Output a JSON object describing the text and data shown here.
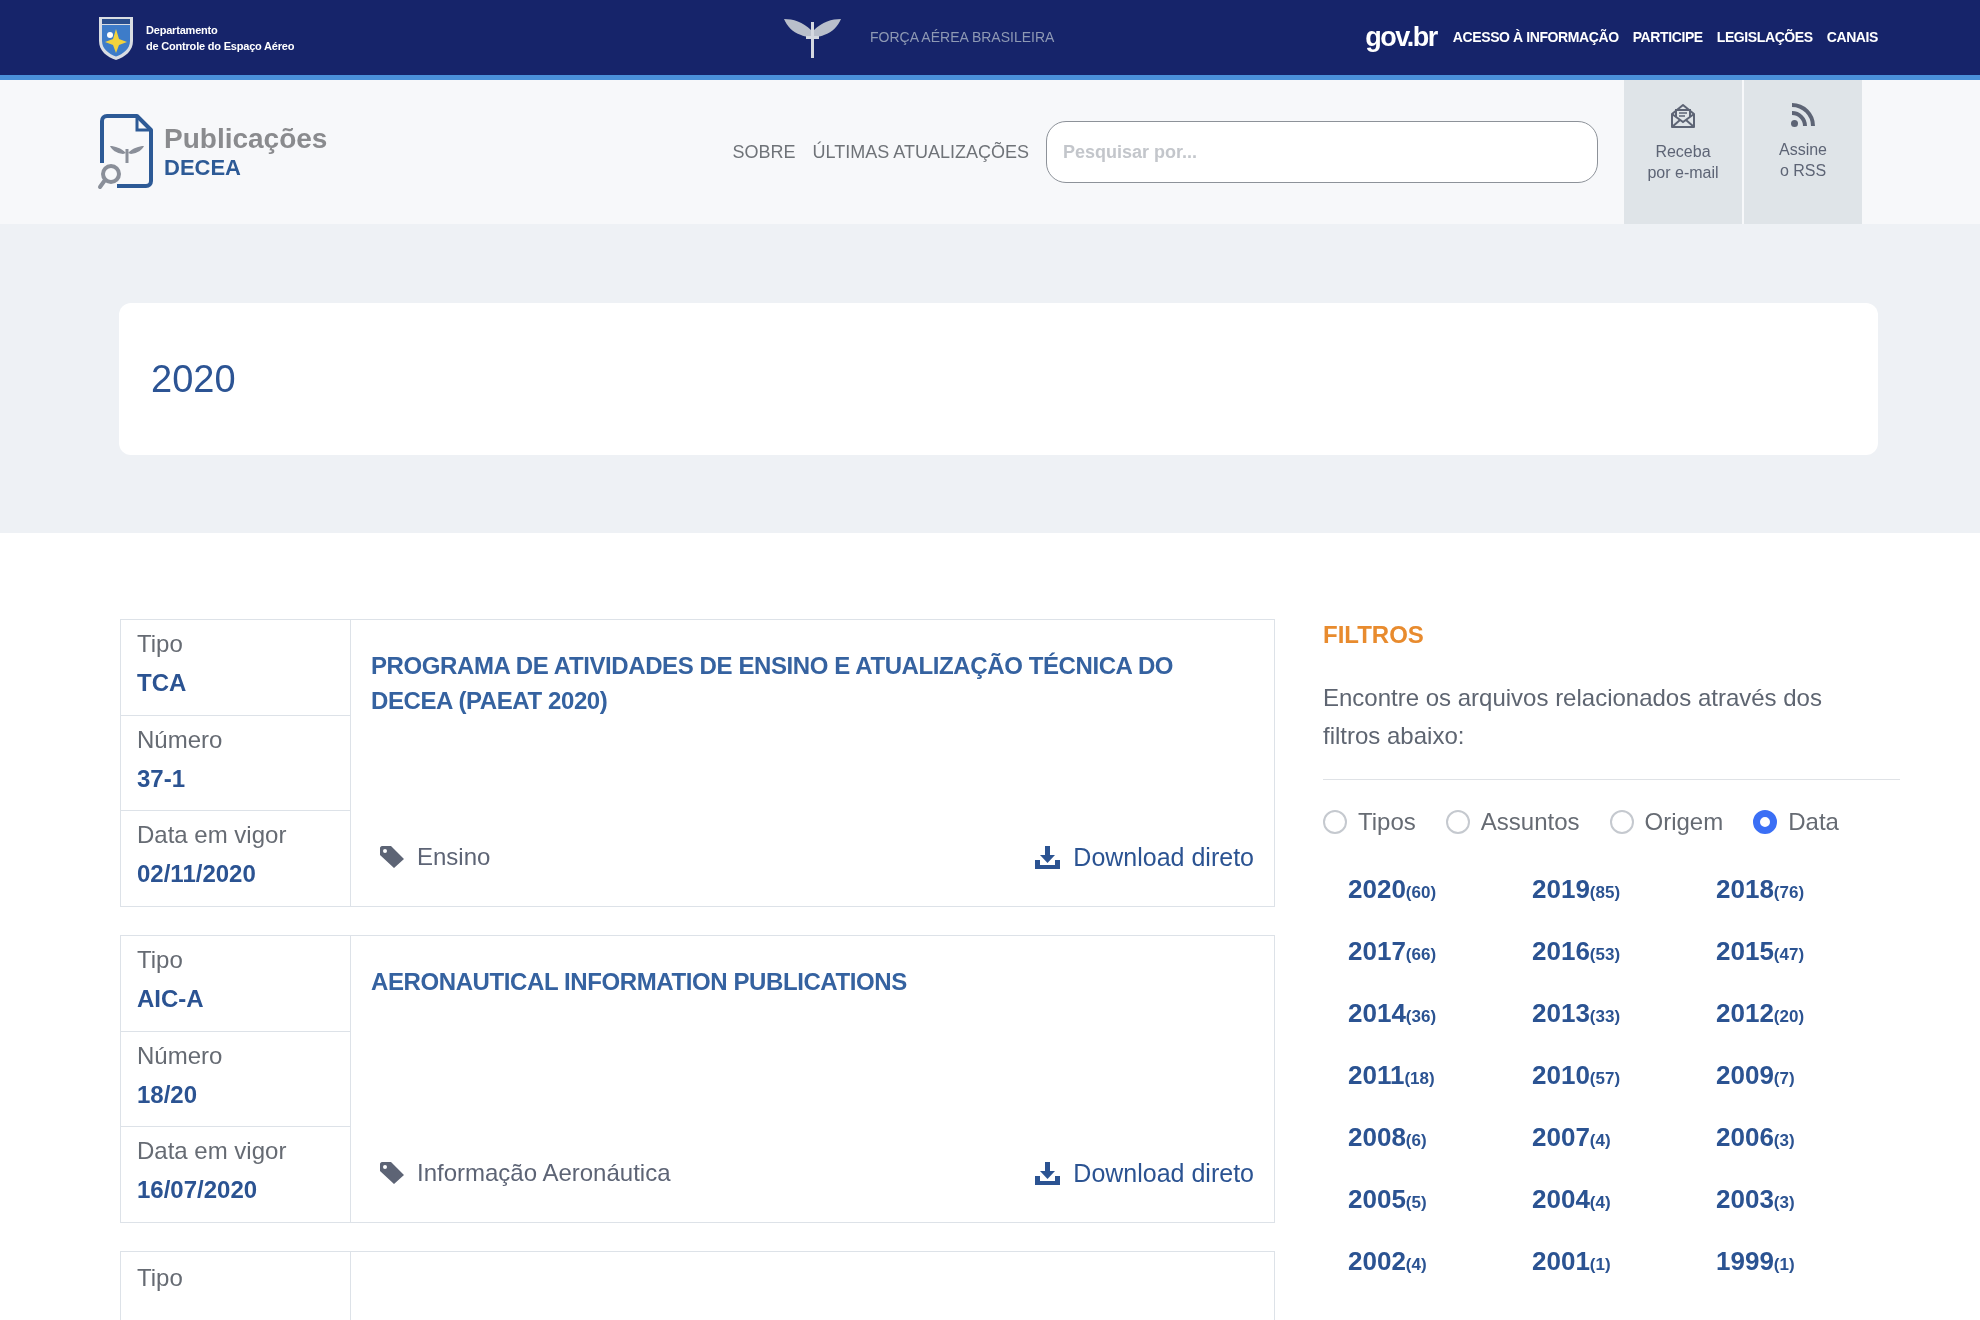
{
  "top_bar": {
    "department": [
      "Departamento",
      "de Controle do Espaço Aéreo"
    ],
    "center_label": "FORÇA AÉREA BRASILEIRA",
    "gov_logo": "gov.br",
    "links": [
      "ACESSO À INFORMAÇÃO",
      "PARTICIPE",
      "LEGISLAÇÕES",
      "CANAIS"
    ]
  },
  "header": {
    "logo": {
      "title": "Publicações",
      "subtitle": "DECEA"
    },
    "nav": [
      "SOBRE",
      "ÚLTIMAS ATUALIZAÇÕES"
    ],
    "search": {
      "placeholder": "Pesquisar por..."
    },
    "actions": [
      {
        "kind": "email",
        "lines": [
          "Receba",
          "por e-mail"
        ]
      },
      {
        "kind": "rss",
        "lines": [
          "Assine",
          "o RSS"
        ]
      }
    ]
  },
  "page_title": "2020",
  "publications": [
    {
      "fields": [
        {
          "label": "Tipo",
          "value": "TCA"
        },
        {
          "label": "Número",
          "value": "37-1"
        },
        {
          "label": "Data em vigor",
          "value": "02/11/2020"
        }
      ],
      "title": "PROGRAMA DE ATIVIDADES DE ENSINO E ATUALIZAÇÃO TÉCNICA DO DECEA (PAEAT 2020)",
      "tag": "Ensino",
      "download": "Download direto"
    },
    {
      "fields": [
        {
          "label": "Tipo",
          "value": "AIC-A"
        },
        {
          "label": "Número",
          "value": "18/20"
        },
        {
          "label": "Data em vigor",
          "value": "16/07/2020"
        }
      ],
      "title": "AERONAUTICAL INFORMATION PUBLICATIONS",
      "tag": "Informação Aeronáutica",
      "download": "Download direto"
    },
    {
      "fields": [
        {
          "label": "Tipo"
        }
      ]
    }
  ],
  "filters": {
    "title": "FILTROS",
    "description": "Encontre os arquivos relacionados através dos filtros abaixo:",
    "options": [
      {
        "label": "Tipos",
        "selected": false
      },
      {
        "label": "Assuntos",
        "selected": false
      },
      {
        "label": "Origem",
        "selected": false
      },
      {
        "label": "Data",
        "selected": true
      }
    ],
    "years": [
      {
        "year": "2020",
        "count": "(60)"
      },
      {
        "year": "2019",
        "count": "(85)"
      },
      {
        "year": "2018",
        "count": "(76)"
      },
      {
        "year": "2017",
        "count": "(66)"
      },
      {
        "year": "2016",
        "count": "(53)"
      },
      {
        "year": "2015",
        "count": "(47)"
      },
      {
        "year": "2014",
        "count": "(36)"
      },
      {
        "year": "2013",
        "count": "(33)"
      },
      {
        "year": "2012",
        "count": "(20)"
      },
      {
        "year": "2011",
        "count": "(18)"
      },
      {
        "year": "2010",
        "count": "(57)"
      },
      {
        "year": "2009",
        "count": "(7)"
      },
      {
        "year": "2008",
        "count": "(6)"
      },
      {
        "year": "2007",
        "count": "(4)"
      },
      {
        "year": "2006",
        "count": "(3)"
      },
      {
        "year": "2005",
        "count": "(5)"
      },
      {
        "year": "2004",
        "count": "(4)"
      },
      {
        "year": "2003",
        "count": "(3)"
      },
      {
        "year": "2002",
        "count": "(4)"
      },
      {
        "year": "2001",
        "count": "(1)"
      },
      {
        "year": "1999",
        "count": "(1)"
      }
    ]
  }
}
